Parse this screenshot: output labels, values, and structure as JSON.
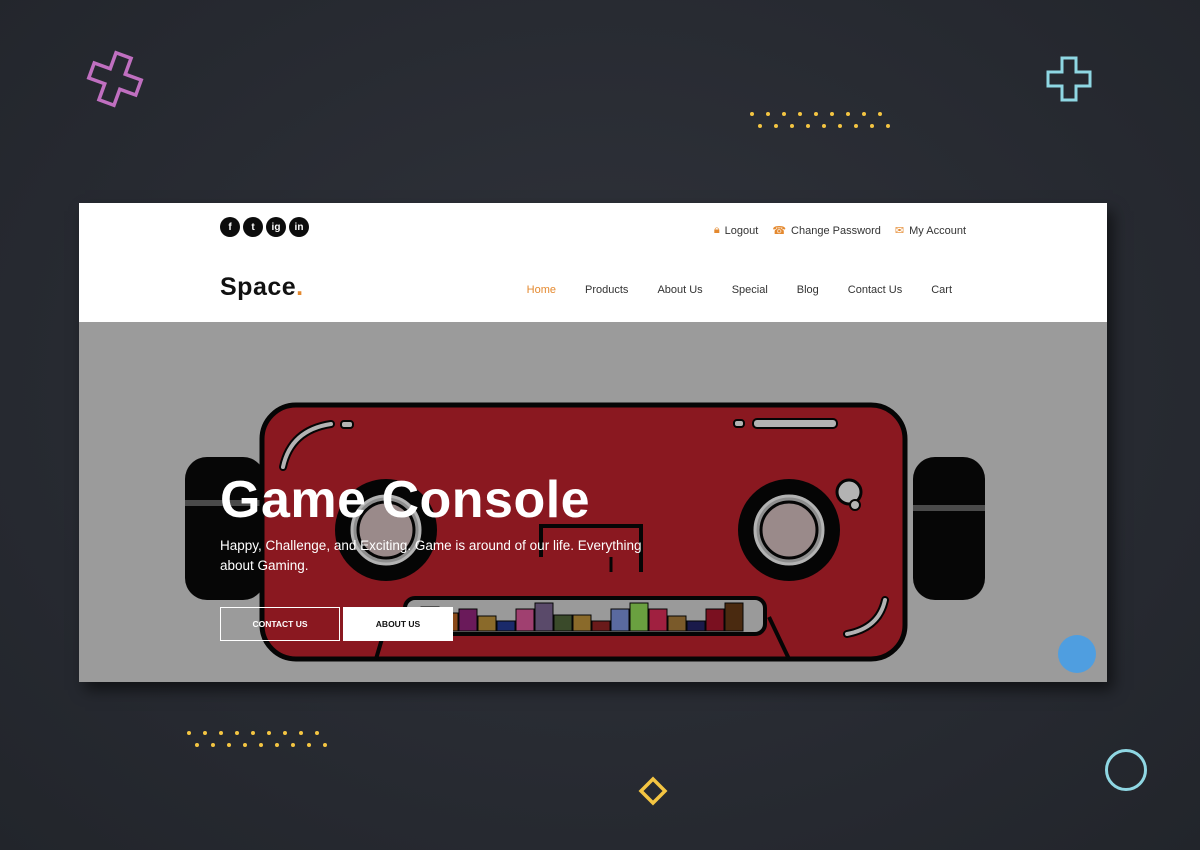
{
  "top_bar": {
    "social_icons": [
      "facebook-icon",
      "twitter-icon",
      "instagram-icon",
      "linkedin-icon"
    ],
    "social_glyphs": [
      "f",
      "t",
      "ig",
      "in"
    ],
    "account_links": [
      {
        "label": "Logout",
        "icon": "lock-icon"
      },
      {
        "label": "Change Password",
        "icon": "phone-icon"
      },
      {
        "label": "My Account",
        "icon": "envelope-icon"
      }
    ]
  },
  "brand": {
    "name": "Space",
    "dot": "."
  },
  "nav": {
    "items": [
      "Home",
      "Products",
      "About Us",
      "Special",
      "Blog",
      "Contact Us",
      "Cart"
    ],
    "active": "Home"
  },
  "hero": {
    "title": "Game Console",
    "subtitle": "Happy, Challenge, and Exciting. Game is around of our life. Everything about Gaming.",
    "buttons": {
      "contact": "CONTACT US",
      "about": "ABOUT US"
    }
  },
  "colors": {
    "accent": "#e4892f",
    "page_bg": "#2a2d35",
    "hero_bg": "#9b9b9b",
    "console_red": "#8a1820",
    "fab": "#4f9ee0",
    "dots": "#f4c542"
  }
}
